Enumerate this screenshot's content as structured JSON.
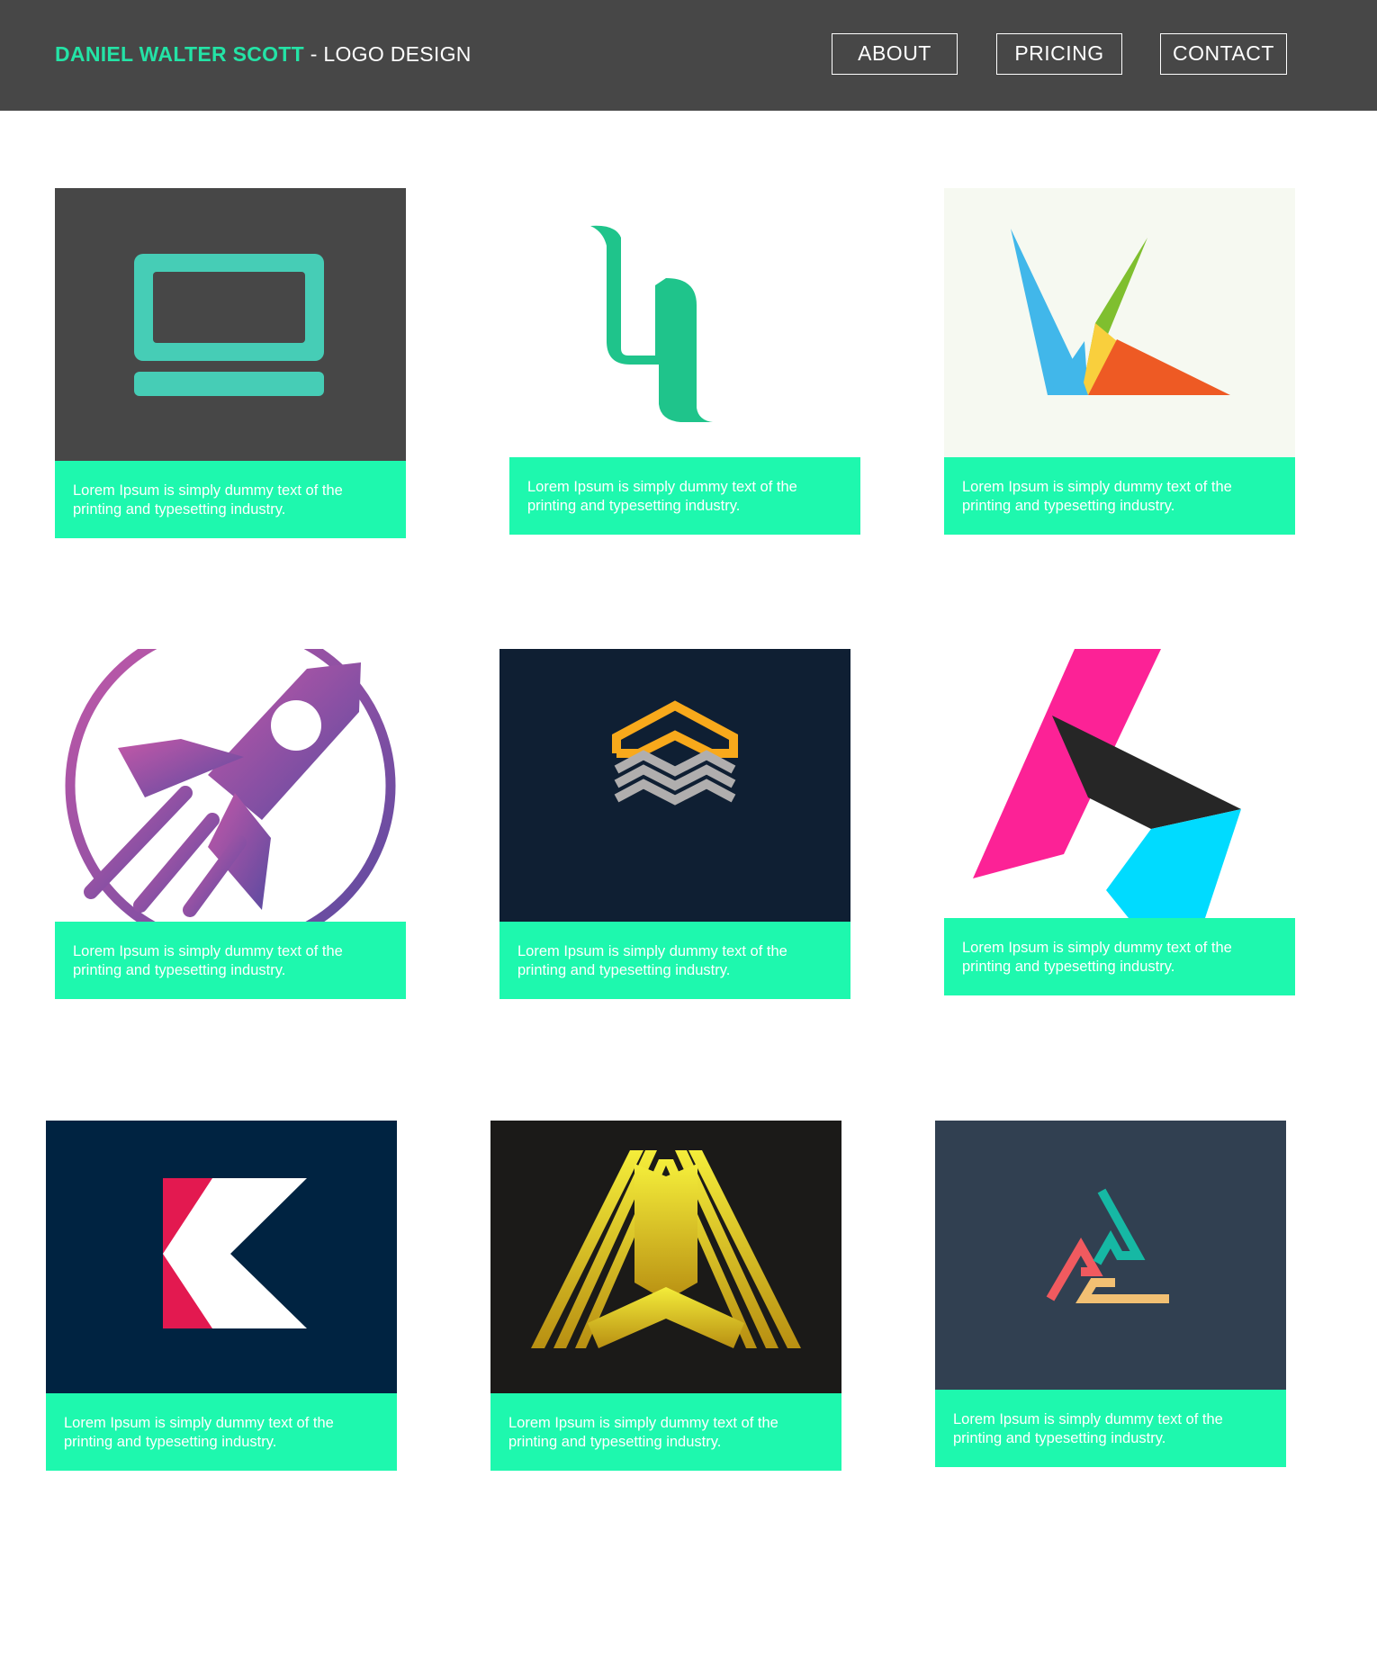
{
  "header": {
    "brand_name": "DANIEL WALTER SCOTT",
    "brand_suffix": " - LOGO DESIGN",
    "nav": [
      "ABOUT",
      "PRICING",
      "CONTACT"
    ]
  },
  "colors": {
    "header_bg": "#474747",
    "accent": "#24e3a6",
    "caption_bg": "#1ef8ae"
  },
  "cards": [
    {
      "logo": "laptop-logo",
      "caption": "Lorem Ipsum is simply dummy text of the printing and typesetting industry."
    },
    {
      "logo": "ribbon-b-logo",
      "caption": "Lorem Ipsum is simply dummy text of the printing and typesetting industry."
    },
    {
      "logo": "geometric-k-logo",
      "caption": "Lorem Ipsum is simply dummy text of the printing and typesetting industry."
    },
    {
      "logo": "rocket-logo",
      "caption": "Lorem Ipsum is simply dummy text of the printing and typesetting industry."
    },
    {
      "logo": "chevron-stack-logo",
      "caption": "Lorem Ipsum is simply dummy text of the printing and typesetting industry."
    },
    {
      "logo": "folded-h-logo",
      "caption": "Lorem Ipsum is simply dummy text of the printing and typesetting industry."
    },
    {
      "logo": "letter-k-logo",
      "caption": "Lorem Ipsum is simply dummy text of the printing and typesetting industry."
    },
    {
      "logo": "golden-a-logo",
      "caption": "Lorem Ipsum is simply dummy text of the printing and typesetting industry."
    },
    {
      "logo": "triangle-maze-logo",
      "caption": "Lorem Ipsum is simply dummy text of the printing and typesetting industry."
    }
  ]
}
